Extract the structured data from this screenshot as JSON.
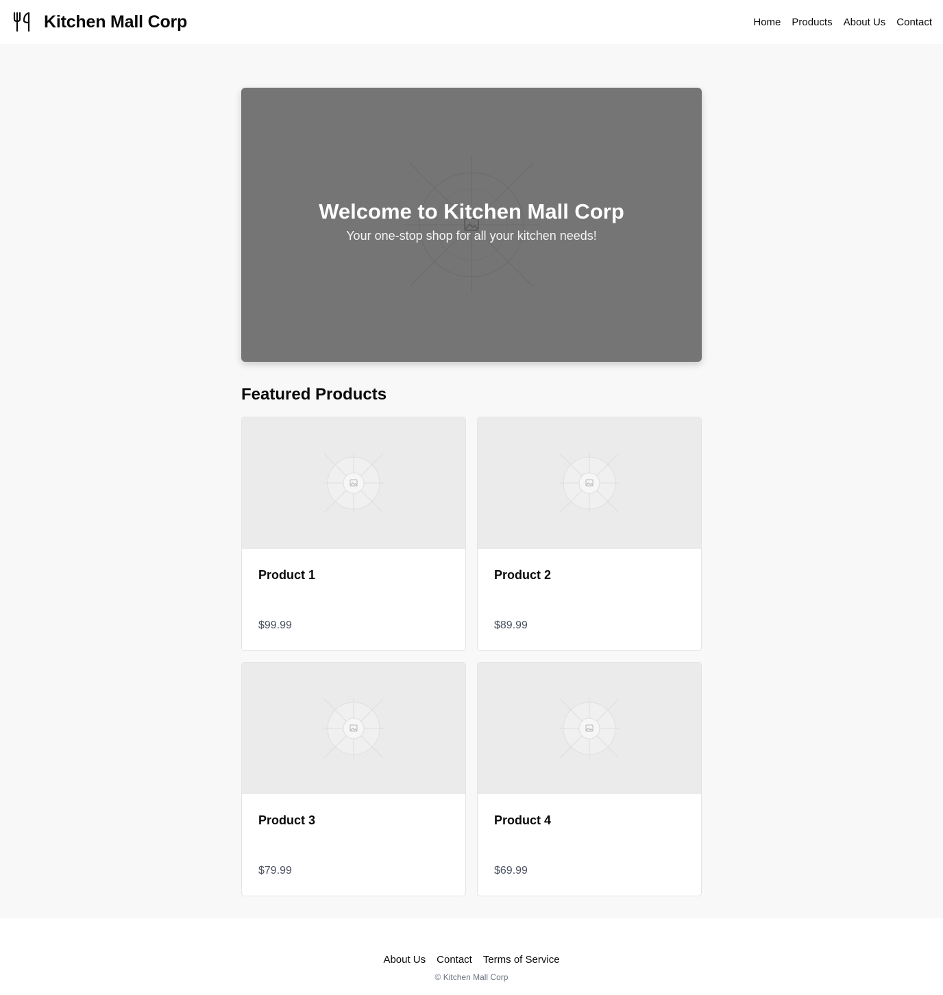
{
  "header": {
    "logo_icon": "fork-knife-icon",
    "brand": "Kitchen Mall Corp",
    "nav": [
      {
        "label": "Home"
      },
      {
        "label": "Products"
      },
      {
        "label": "About Us"
      },
      {
        "label": "Contact"
      }
    ]
  },
  "hero": {
    "image_icon": "image-placeholder-icon",
    "title": "Welcome to Kitchen Mall Corp",
    "subtitle": "Your one-stop shop for all your kitchen needs!"
  },
  "featured": {
    "title": "Featured Products",
    "products": [
      {
        "name": "Product 1",
        "price": "$99.99",
        "image_icon": "image-placeholder-icon"
      },
      {
        "name": "Product 2",
        "price": "$89.99",
        "image_icon": "image-placeholder-icon"
      },
      {
        "name": "Product 3",
        "price": "$79.99",
        "image_icon": "image-placeholder-icon"
      },
      {
        "name": "Product 4",
        "price": "$69.99",
        "image_icon": "image-placeholder-icon"
      }
    ]
  },
  "footer": {
    "links": [
      {
        "label": "About Us"
      },
      {
        "label": "Contact"
      },
      {
        "label": "Terms of Service"
      }
    ],
    "copyright": "© Kitchen Mall Corp"
  },
  "colors": {
    "page_bg": "#f8f8f8",
    "hero_bg": "#757575",
    "card_image_bg": "#ebebeb",
    "price_text": "#4b5260"
  }
}
